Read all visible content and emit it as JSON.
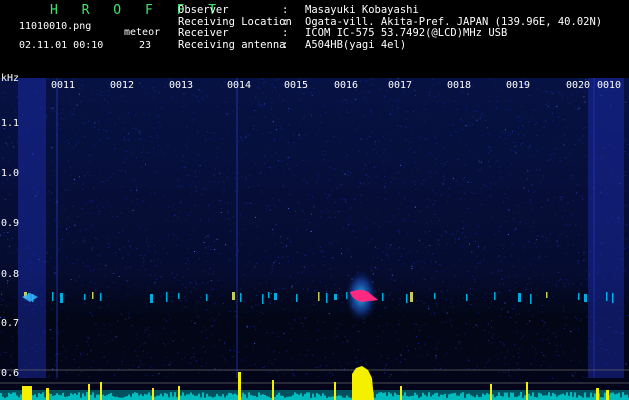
{
  "header": {
    "logo": "H R O F F T",
    "filename": "11010010.png",
    "datetime": "02.11.01 00:10",
    "meteor_label": "meteor",
    "meteor_count": "23"
  },
  "info": {
    "rows": [
      {
        "key": "Observer",
        "sep": ":",
        "value": "Masayuki Kobayashi"
      },
      {
        "key": "Receiving Location",
        "sep": ":",
        "value": "Ogata-vill. Akita-Pref. JAPAN (139.96E, 40.02N)"
      },
      {
        "key": "Receiver",
        "sep": ":",
        "value": "ICOM IC-575 53.7492(@LCD)MHz USB"
      },
      {
        "key": "Receiving antenna",
        "sep": ":",
        "value": "A504HB(yagi 4el)"
      }
    ]
  },
  "spectrogram": {
    "y_unit": "kHz",
    "y_ticks": [
      "1.1",
      "1.0",
      "0.9",
      "0.8",
      "0.7",
      "0.6"
    ],
    "x_ticks": [
      "0011",
      "0012",
      "0013",
      "0014",
      "0015",
      "0016",
      "0017",
      "0018",
      "0019",
      "0020",
      "0010"
    ],
    "colors": {
      "background": "#000a2a",
      "noise": "#1a2aa0",
      "trace": "#00c8ff",
      "meteor": "#ff2a80",
      "power": "#f5f000",
      "power_baseline": "#00e0e0"
    }
  }
}
